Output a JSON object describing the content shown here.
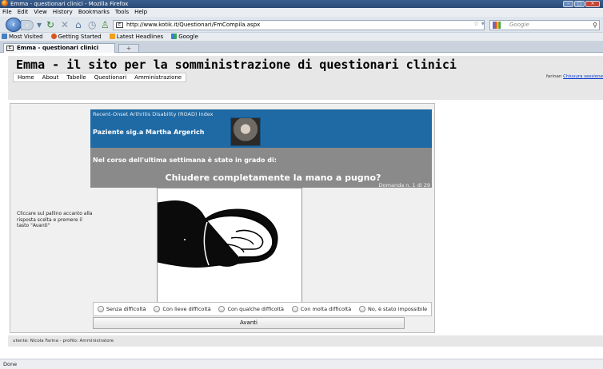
{
  "window": {
    "title": "Emma - questionari clinici - Mozilla Firefox"
  },
  "menu": [
    "File",
    "Edit",
    "View",
    "History",
    "Bookmarks",
    "Tools",
    "Help"
  ],
  "navigation": {
    "url": "http://www.kotik.it/Questionari/FmCompila.aspx",
    "search_placeholder": "Google"
  },
  "bookmarks": [
    {
      "label": "Most Visited",
      "icon": "most-visited-icon",
      "color": "#4a7fc1"
    },
    {
      "label": "Getting Started",
      "icon": "firefox-icon",
      "color": "#d9541e"
    },
    {
      "label": "Latest Headlines",
      "icon": "rss-icon",
      "color": "#f0a020"
    },
    {
      "label": "Google",
      "icon": "google-icon",
      "color": "#3b78e7"
    }
  ],
  "tab": {
    "label": "Emma - questionari clinici"
  },
  "site": {
    "title": "Emma - il sito per la somministrazione di questionari clinici",
    "nav": [
      "Home",
      "About",
      "Tabelle",
      "Questionari",
      "Amministrazione"
    ],
    "user": "farinan",
    "logout": "Chiusura sessione"
  },
  "questionnaire": {
    "index_name": "Recent-Onset Arthritis Disability (ROAD) Index",
    "patient": "Paziente sig.a Martha Argerich",
    "lead": "Nel corso dell'ultima settimana è stato in grado di:",
    "question": "Chiudere completamente la mano a pugno?",
    "counter": "Domanda n. 1 di 29",
    "instructions": "Cliccare sul pallino accanto alla risposta scelta e premere il tasto \"Avanti\"",
    "options": [
      "Senza difficoltà",
      "Con lieve difficoltà",
      "Con qualche difficoltà",
      "Con molta difficoltà",
      "No, è stato impossibile"
    ],
    "next_button": "Avanti"
  },
  "footer": "utente: Nicola Farina - profilo: Amministratore",
  "status": "Done",
  "colors": {
    "question_header": "#1f6aa5",
    "question_body": "#8a8a8a"
  }
}
